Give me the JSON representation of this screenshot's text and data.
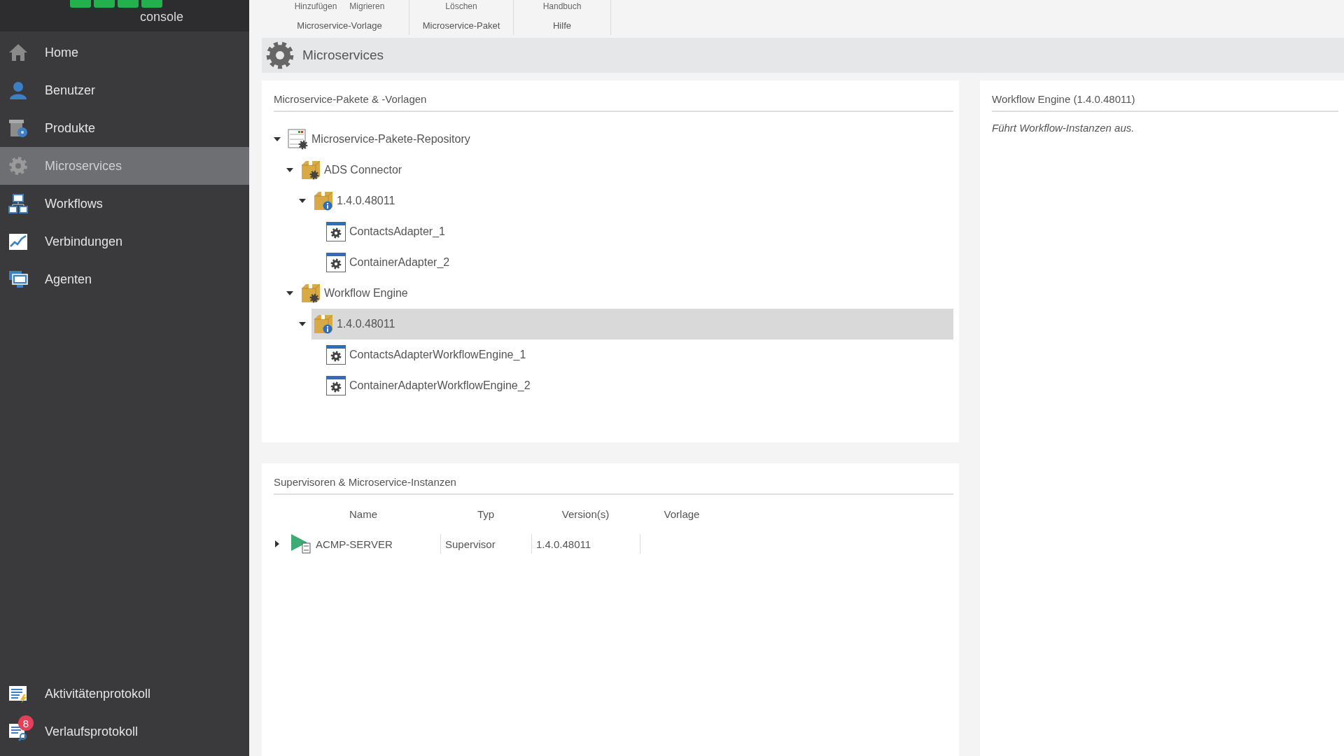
{
  "logo": {
    "text": "console"
  },
  "ribbon": {
    "groups": [
      {
        "label": "Microservice-Vorlage",
        "buttons": [
          "Hinzufügen",
          "Migrieren"
        ]
      },
      {
        "label": "Microservice-Paket",
        "buttons": [
          "Löschen"
        ]
      },
      {
        "label": "Hilfe",
        "buttons": [
          "Handbuch"
        ]
      }
    ]
  },
  "sidebar": {
    "items": [
      {
        "label": "Home",
        "selected": false
      },
      {
        "label": "Benutzer",
        "selected": false
      },
      {
        "label": "Produkte",
        "selected": false
      },
      {
        "label": "Microservices",
        "selected": true
      },
      {
        "label": "Workflows",
        "selected": false
      },
      {
        "label": "Verbindungen",
        "selected": false
      },
      {
        "label": "Agenten",
        "selected": false
      }
    ],
    "bottom_items": [
      {
        "label": "Aktivitätenprotokoll",
        "selected": false
      },
      {
        "label": "Verlaufsprotokoll",
        "selected": false,
        "badge": "8"
      }
    ]
  },
  "page_header": {
    "title": "Microservices"
  },
  "packages_panel": {
    "title": "Microservice-Pakete & -Vorlagen",
    "tree": [
      {
        "kind": "repository",
        "label": "Microservice-Pakete-Repository",
        "expanded": true,
        "selected": false,
        "children": [
          {
            "kind": "package",
            "label": "ADS Connector",
            "expanded": true,
            "selected": false,
            "children": [
              {
                "kind": "version",
                "label": "1.4.0.48011",
                "expanded": true,
                "selected": false,
                "children": [
                  {
                    "kind": "template",
                    "label": "ContactsAdapter_1",
                    "selected": false
                  },
                  {
                    "kind": "template",
                    "label": "ContainerAdapter_2",
                    "selected": false
                  }
                ]
              }
            ]
          },
          {
            "kind": "package",
            "label": "Workflow Engine",
            "expanded": true,
            "selected": false,
            "children": [
              {
                "kind": "version",
                "label": "1.4.0.48011",
                "expanded": true,
                "selected": true,
                "children": [
                  {
                    "kind": "template",
                    "label": "ContactsAdapterWorkflowEngine_1",
                    "selected": false
                  },
                  {
                    "kind": "template",
                    "label": "ContainerAdapterWorkflowEngine_2",
                    "selected": false
                  }
                ]
              }
            ]
          }
        ]
      }
    ]
  },
  "instances_panel": {
    "title": "Supervisoren & Microservice-Instanzen",
    "columns": [
      "Name",
      "Typ",
      "Version(s)",
      "Vorlage"
    ],
    "rows": [
      {
        "expanded": false,
        "cells": [
          "ACMP-SERVER",
          "Supervisor",
          "1.4.0.48011"
        ]
      }
    ]
  },
  "detail_panel": {
    "title": "Workflow Engine (1.4.0.48011)",
    "description": "Führt Workflow-Instanzen aus."
  }
}
